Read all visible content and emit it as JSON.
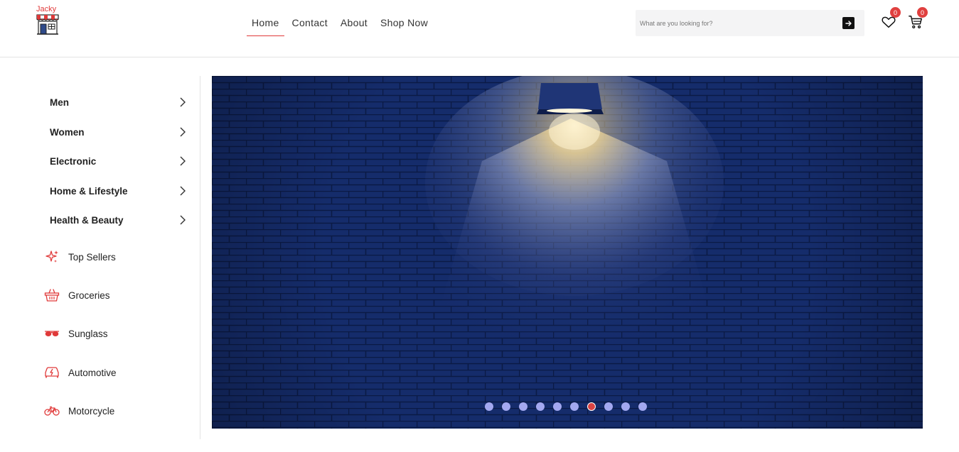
{
  "brand": {
    "name": "Jacky",
    "accent": "#e03a3a"
  },
  "nav": {
    "items": [
      {
        "label": "Home",
        "active": true
      },
      {
        "label": "Contact",
        "active": false
      },
      {
        "label": "About",
        "active": false
      },
      {
        "label": "Shop Now",
        "active": false
      }
    ]
  },
  "search": {
    "placeholder": "What are you looking for?",
    "button_icon": "arrow-right-icon"
  },
  "wishlist": {
    "icon": "heart-icon",
    "count": "0"
  },
  "cart": {
    "icon": "cart-icon",
    "count": "0"
  },
  "sidebar": {
    "categories": [
      {
        "label": "Men",
        "icon": "chevron-right-icon"
      },
      {
        "label": "Women",
        "icon": "chevron-right-icon"
      },
      {
        "label": "Electronic",
        "icon": "chevron-right-icon"
      },
      {
        "label": "Home & Lifestyle",
        "icon": "chevron-right-icon"
      },
      {
        "label": "Health & Beauty",
        "icon": "chevron-right-icon"
      }
    ],
    "extras": [
      {
        "label": "Top Sellers",
        "icon": "sparkle-icon"
      },
      {
        "label": "Groceries",
        "icon": "basket-icon"
      },
      {
        "label": "Sunglass",
        "icon": "sunglasses-icon"
      },
      {
        "label": "Automotive",
        "icon": "car-icon"
      },
      {
        "label": "Motorcycle",
        "icon": "bicycle-icon"
      }
    ]
  },
  "banner": {
    "image": "wall-lamp-on-blue-brick-wall",
    "slide_count": 10,
    "active_slide": 7,
    "colors": {
      "wall": "#142a66",
      "dot": "#a3a8f0",
      "dot_active": "#d94343"
    }
  }
}
